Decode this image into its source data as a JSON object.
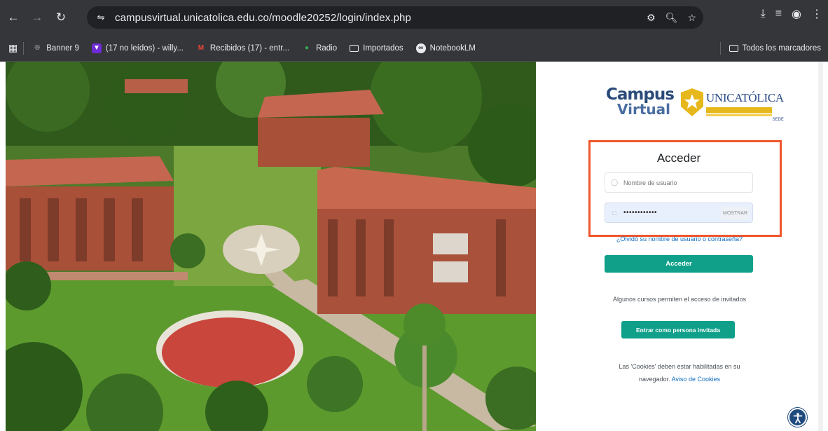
{
  "browser": {
    "url": "campusvirtual.unicatolica.edu.co/moodle20252/login/index.php",
    "bookmarks": [
      {
        "label": "Banner 9",
        "icon": "globe-icon",
        "color": "#9aa0a6"
      },
      {
        "label": "(17 no leídos) - willy...",
        "icon": "mail-icon",
        "color": "#6f2bd6"
      },
      {
        "label": "Recibidos (17) - entr...",
        "icon": "gmail-icon",
        "color": "#ea4335"
      },
      {
        "label": "Radio",
        "icon": "dot-icon",
        "color": "#34a853"
      },
      {
        "label": "Importados",
        "icon": "folder-icon",
        "color": "#e8eaed"
      },
      {
        "label": "NotebookLM",
        "icon": "notebooklm-icon",
        "color": "#e8eaed"
      }
    ],
    "all_bookmarks_label": "Todos los marcadores"
  },
  "login": {
    "title": "Acceder",
    "username_placeholder": "Nombre de usuario",
    "password_value": "••••••••••••",
    "reveal_label": "MOSTRAR",
    "forgot_link": "¿Olvidó su nombre de usuario o contraseña?",
    "submit_label": "Acceder",
    "guest_note": "Algunos cursos permiten el acceso de invitados",
    "guest_button": "Entrar como persona invitada",
    "cookie_note": "Las 'Cookies' deben estar habilitadas en su navegador.",
    "cookie_link": "Aviso de Cookies"
  },
  "logo": {
    "campus": "Campus",
    "virtual": "Virtual",
    "unicatolica": "UNICATÓLICA",
    "tagline": "SEDE"
  },
  "colors": {
    "accent": "#10a08a",
    "highlight": "#f0562b",
    "link": "#0f6cbf"
  }
}
